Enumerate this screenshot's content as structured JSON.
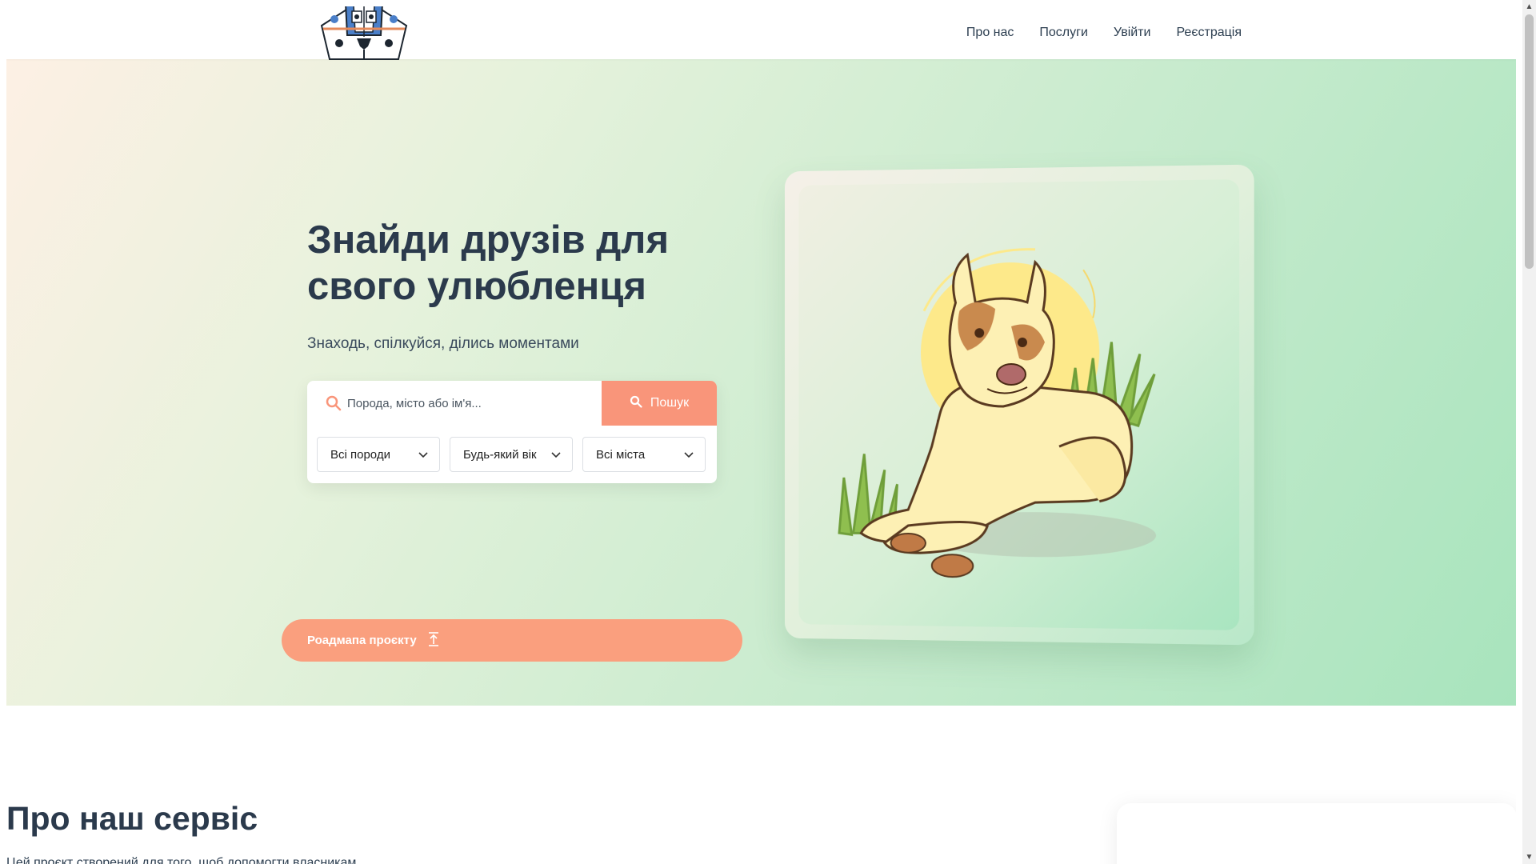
{
  "nav": {
    "about": "Про нас",
    "services": "Послуги",
    "login": "Увійти",
    "register": "Реєстрація"
  },
  "hero": {
    "title_line1": "Знайди друзів для",
    "title_line2": "свого улюбленця",
    "subtitle": "Знаходь, спілкуйся, ділись моментами"
  },
  "search": {
    "placeholder": "Порода, місто або ім'я...",
    "button_label": "Пошук",
    "filters": [
      "Всі породи",
      "Будь-який вік",
      "Всі міста"
    ]
  },
  "roadmap": {
    "label": "Роадмапа проєкту"
  },
  "about": {
    "title": "Про наш сервіс",
    "text": "Цей проєкт створений для того, щоб допомогти власникам"
  },
  "colors": {
    "accent": "#f9957a",
    "heading": "#2b3a4c",
    "hero_gradient_start": "#fdf0e4",
    "hero_gradient_end": "#a8e4bd"
  },
  "icons": {
    "logo": "dog-face-logo",
    "search": "search-icon",
    "chevron": "chevron-down-icon",
    "roadmap": "upload-arrow-icon",
    "illustration": "dog-illustration"
  }
}
